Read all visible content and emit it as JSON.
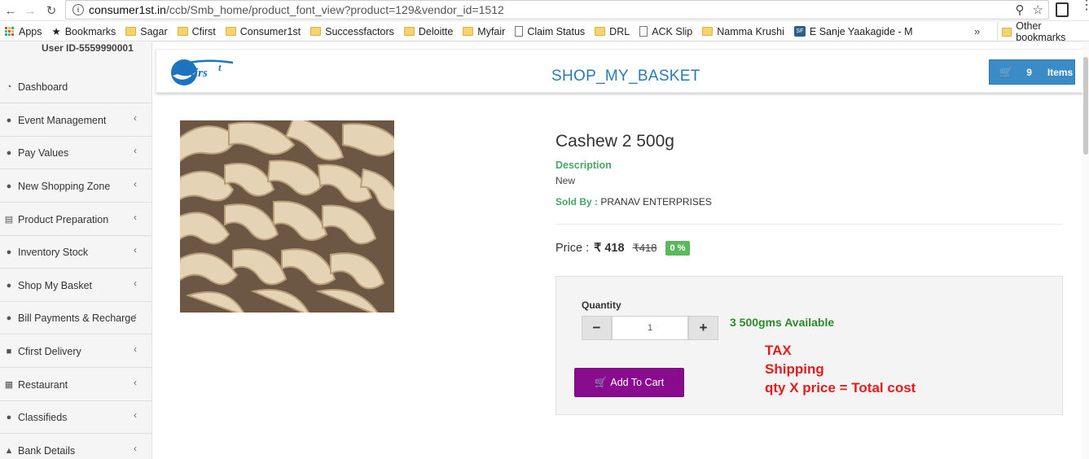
{
  "browser": {
    "url_host": "consumer1st.in",
    "url_path": "/ccb/Smb_home/product_font_view?product=129&vendor_id=1512"
  },
  "bookmarks": {
    "items": [
      "Apps",
      "Bookmarks",
      "Sagar",
      "Cfirst",
      "Consumer1st",
      "Successfactors",
      "Deloitte",
      "Myfair",
      "Claim Status",
      "DRL",
      "ACK Slip",
      "Namma Krushi",
      "E Sanje Yaakagide - M"
    ],
    "more": "»",
    "other": "Other bookmarks"
  },
  "sidebar": {
    "user_id": "User ID-5559990001",
    "items": [
      {
        "label": "Dashboard",
        "icon": "dashboard-icon"
      },
      {
        "label": "Event Management",
        "icon": "users-icon"
      },
      {
        "label": "Pay Values",
        "icon": "globe-icon"
      },
      {
        "label": "New Shopping Zone",
        "icon": "globe-icon"
      },
      {
        "label": "Product Preparation",
        "icon": "file-icon"
      },
      {
        "label": "Inventory Stock",
        "icon": "user-icon"
      },
      {
        "label": "Shop My Basket",
        "icon": "globe-icon"
      },
      {
        "label": "Bill Payments & Recharge",
        "icon": "globe-icon"
      },
      {
        "label": "Cfirst Delivery",
        "icon": "truck-icon"
      },
      {
        "label": "Restaurant",
        "icon": "table-icon"
      },
      {
        "label": "Classifieds",
        "icon": "globe-icon"
      },
      {
        "label": "Bank Details",
        "icon": "bank-icon"
      }
    ]
  },
  "header": {
    "title": "SHOP_MY_BASKET",
    "cart_count": "9",
    "cart_label": "Items"
  },
  "product": {
    "name": "Cashew 2 500g",
    "description_heading": "Description",
    "description": "New",
    "sold_by_label": "Sold By :",
    "sold_by": "PRANAV ENTERPRISES",
    "price_label": "Price :",
    "price": "₹ 418",
    "original_price": "₹418",
    "discount": "0 %"
  },
  "purchase": {
    "quantity_label": "Quantity",
    "quantity": "1",
    "availability": "3 500gms Available",
    "add_to_cart": "Add To Cart",
    "notes": [
      "TAX",
      "Shipping",
      "qty X price = Total cost"
    ]
  },
  "colors": {
    "accent_blue": "#3a8bc6",
    "title_blue": "#2a7ab5",
    "green": "#4aa36b",
    "purple": "#8a0c8e",
    "red_note": "#e11c1c"
  }
}
